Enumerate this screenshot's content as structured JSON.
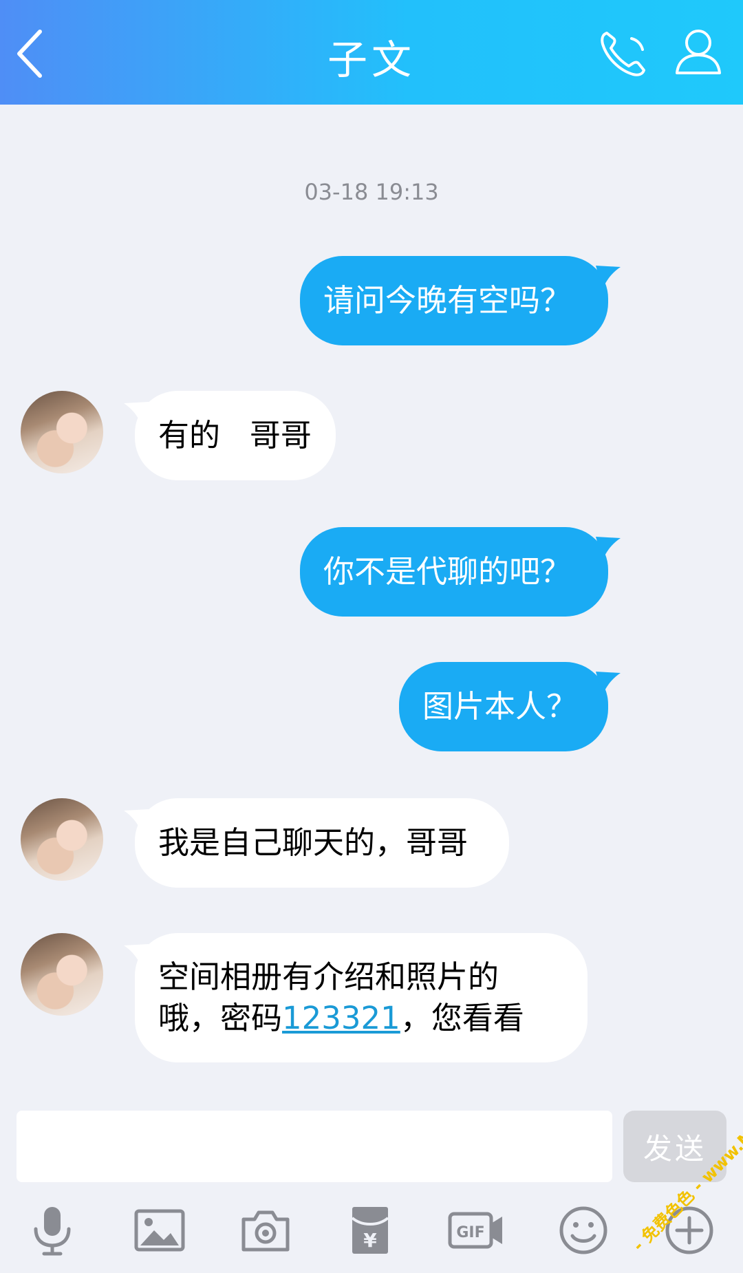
{
  "header": {
    "title": "子文",
    "icons": [
      "back-icon",
      "phone-icon",
      "user-icon"
    ],
    "gradient_colors": [
      "#4f8ef6",
      "#1fc9fb"
    ]
  },
  "chat": {
    "timestamp": "03-18 19:13",
    "messages": [
      {
        "direction": "out",
        "text": "请问今晚有空吗？"
      },
      {
        "direction": "in",
        "text": "有的   哥哥"
      },
      {
        "direction": "out",
        "text": "你不是代聊的吧？"
      },
      {
        "direction": "out",
        "text": "图片本人？"
      },
      {
        "direction": "in",
        "text": "我是自己聊天的，哥哥"
      },
      {
        "direction": "in",
        "lines": [
          "空间相册有介绍和照片的",
          "哦，密码"
        ],
        "link": "123321",
        "suffix": "，您看看"
      }
    ],
    "out_bubble_color": "#1aabf4",
    "in_bubble_color": "#ffffff"
  },
  "composer": {
    "input_value": "",
    "send_label": "发送"
  },
  "toolbar": {
    "icons": [
      "microphone-icon",
      "image-icon",
      "camera-icon",
      "red-packet-icon",
      "gif-icon",
      "emoji-icon",
      "plus-icon"
    ]
  },
  "watermark": {
    "text": "- 免费色色 - www.MFsese.com"
  }
}
